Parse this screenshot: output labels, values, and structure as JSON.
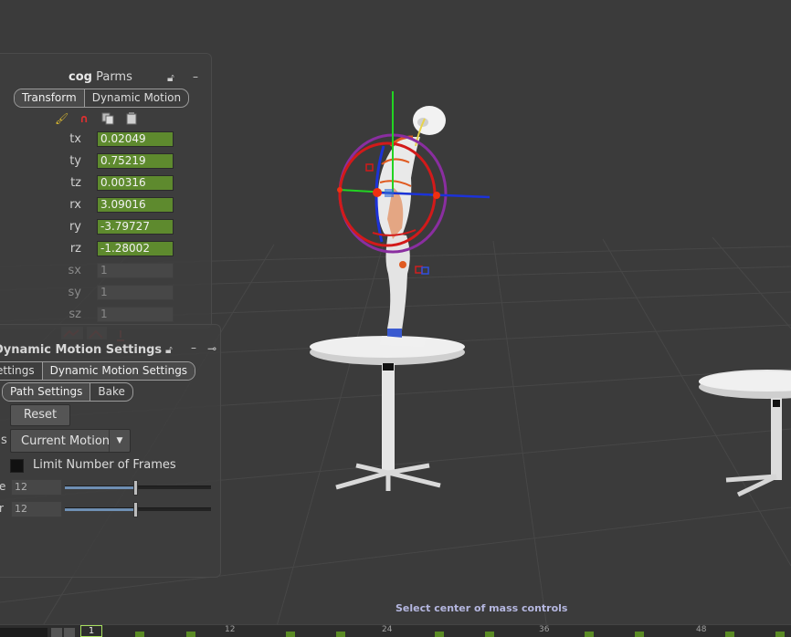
{
  "parms_panel": {
    "title_bold": "cog",
    "title_rest": "Parms",
    "tabs": [
      {
        "label": "Transform",
        "active": true
      },
      {
        "label": "Dynamic Motion",
        "active": false
      }
    ],
    "header_icons": [
      "lock-icon",
      "minimize-icon"
    ],
    "tool_icons": [
      "brush-icon",
      "magnet-icon",
      "copy-icon",
      "paste-icon"
    ],
    "params": [
      {
        "label": "tx",
        "value": "0.02049",
        "active": true
      },
      {
        "label": "ty",
        "value": "0.75219",
        "active": true
      },
      {
        "label": "tz",
        "value": "0.00316",
        "active": true
      },
      {
        "label": "rx",
        "value": "3.09016",
        "active": true
      },
      {
        "label": "ry",
        "value": "-3.79727",
        "active": true
      },
      {
        "label": "rz",
        "value": "-1.28002",
        "active": true
      },
      {
        "label": "sx",
        "value": "1",
        "active": false
      },
      {
        "label": "sy",
        "value": "1",
        "active": false
      },
      {
        "label": "sz",
        "value": "1",
        "active": false
      }
    ],
    "footer_icons": [
      "key-icon",
      "key-icon",
      "key-icon"
    ]
  },
  "dms_panel": {
    "title": "Dynamic Motion Settings",
    "header_icons": [
      "lock-icon",
      "minimize-icon",
      "pin-icon"
    ],
    "tabs_row1": [
      {
        "label": "ettings",
        "active": false
      },
      {
        "label": "Dynamic Motion Settings",
        "active": true
      }
    ],
    "tabs_row2": [
      {
        "label": "Path Settings",
        "active": true
      },
      {
        "label": "Bake",
        "active": false
      }
    ],
    "reset_label": "Reset",
    "source_label_fragment": "s",
    "source_value": "Current Motion",
    "limit_frames_label": "Limit Number of Frames",
    "limit_frames_checked": false,
    "sliders": [
      {
        "label_fragment": "e",
        "value": "12",
        "fraction": 0.48
      },
      {
        "label_fragment": "r",
        "value": "12",
        "fraction": 0.48
      }
    ]
  },
  "status_message": "Select center of mass controls",
  "timeline": {
    "current_frame": "1",
    "tick_labels": [
      "12",
      "24",
      "36",
      "48"
    ]
  },
  "colors": {
    "viewport_bg": "#3b3b3b",
    "grid": "#4a4a4a",
    "field_green": "#5e8a2e",
    "status_text": "#b5b7e0"
  }
}
